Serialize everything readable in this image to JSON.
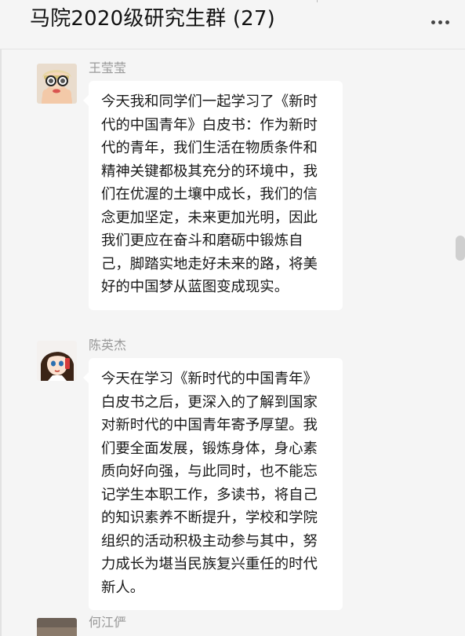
{
  "header": {
    "title": "马院2020级研究生群 (27)",
    "more_icon": "more-dots-icon"
  },
  "messages": [
    {
      "sender": "王莹莹",
      "avatar": "girl-sunglasses-avatar",
      "text": "今天我和同学们一起学习了《新时代的中国青年》白皮书：作为新时代的青年，我们生活在物质条件和精神关键都极其充分的环境中，我们在优渥的土壤中成长，我们的信念更加坚定，未来更加光明，因此我们更应在奋斗和磨砺中锻炼自己，脚踏实地走好未来的路，将美好的中国梦从蓝图变成现实。"
    },
    {
      "sender": "陈英杰",
      "avatar": "anime-girl-phone-avatar",
      "text": "今天在学习《新时代的中国青年》白皮书之后，更深入的了解到国家对新时代的中国青年寄予厚望。我们要全面发展，锻炼身体，身心素质向好向强，与此同时，也不能忘记学生本职工作，多读书，将自己的知识素养不断提升，学校和学院组织的活动积极主动参与其中，努力成长为堪当民族复兴重任的时代新人。"
    },
    {
      "sender": "何江俨",
      "avatar": "photo-avatar",
      "text": ""
    }
  ],
  "colors": {
    "background": "#f5f5f5",
    "bubble": "#ffffff",
    "sender_name": "#999999",
    "text": "#1a1a1a"
  }
}
